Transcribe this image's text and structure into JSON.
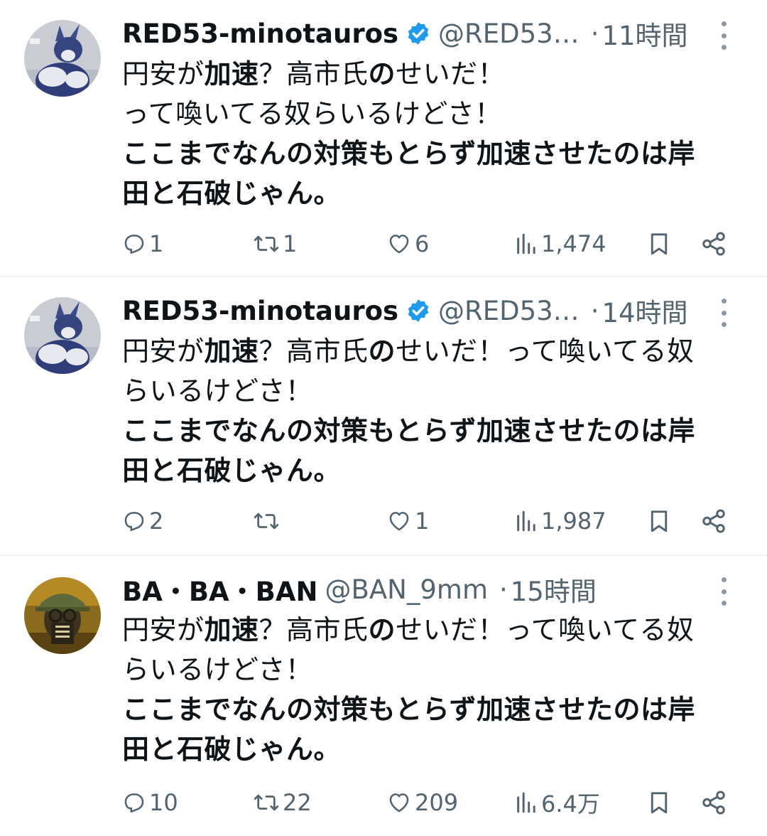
{
  "tweets": [
    {
      "display_name": "RED53-minotauros",
      "handle": "@RED53…",
      "separator": "·",
      "time": "11時間",
      "verified": true,
      "lines": [
        {
          "runs": [
            {
              "t": "円安が",
              "b": false
            },
            {
              "t": "加速",
              "b": true
            },
            {
              "t": "？高市氏",
              "b": false
            },
            {
              "t": "の",
              "b": true
            },
            {
              "t": "せいだ！",
              "b": false
            }
          ]
        },
        {
          "runs": [
            {
              "t": "って喚いてる奴らいるけどさ！",
              "b": false
            }
          ]
        },
        {
          "runs": [
            {
              "t": "ここまでなんの対策もとらず加速させたのは岸",
              "b": true
            }
          ]
        },
        {
          "runs": [
            {
              "t": "田と石破じゃん。",
              "b": true
            }
          ]
        }
      ],
      "stats": {
        "replies": "1",
        "reposts": "1",
        "likes": "6",
        "views": "1,474"
      }
    },
    {
      "display_name": "RED53-minotauros",
      "handle": "@RED53…",
      "separator": "·",
      "time": "14時間",
      "verified": true,
      "lines": [
        {
          "runs": [
            {
              "t": "円安が",
              "b": false
            },
            {
              "t": "加速",
              "b": true
            },
            {
              "t": "？高市氏",
              "b": false
            },
            {
              "t": "の",
              "b": true
            },
            {
              "t": "せいだ！って喚いてる奴",
              "b": false
            }
          ]
        },
        {
          "runs": [
            {
              "t": "らいるけどさ！",
              "b": false
            }
          ]
        },
        {
          "runs": [
            {
              "t": "ここまでなんの対策もとらず加速させたのは岸",
              "b": true
            }
          ]
        },
        {
          "runs": [
            {
              "t": "田と石破じゃん。",
              "b": true
            }
          ]
        }
      ],
      "stats": {
        "replies": "2",
        "reposts": "",
        "likes": "1",
        "views": "1,987"
      }
    },
    {
      "display_name": "BA・BA・BAN",
      "handle": "@BAN_9mm",
      "separator": "·",
      "time": "15時間",
      "verified": false,
      "lines": [
        {
          "runs": [
            {
              "t": "円安が",
              "b": false
            },
            {
              "t": "加速",
              "b": true
            },
            {
              "t": "？高市氏",
              "b": false
            },
            {
              "t": "の",
              "b": true
            },
            {
              "t": "せいだ！って喚いてる奴",
              "b": false
            }
          ]
        },
        {
          "runs": [
            {
              "t": "らいるけどさ！",
              "b": false
            }
          ]
        },
        {
          "runs": [
            {
              "t": "ここまでなんの対策もとらず加速させたのは岸",
              "b": true
            }
          ]
        },
        {
          "runs": [
            {
              "t": "田と石破じゃん。",
              "b": true
            }
          ]
        }
      ],
      "stats": {
        "replies": "10",
        "reposts": "22",
        "likes": "209",
        "views": "6.4万"
      }
    }
  ],
  "icons": {
    "reply": "reply-icon",
    "repost": "repost-icon",
    "like": "heart-icon",
    "views": "views-icon",
    "bookmark": "bookmark-icon",
    "share": "share-icon",
    "more": "more-icon",
    "verified": "verified-badge-icon"
  },
  "colors": {
    "text": "#0f1419",
    "secondary": "#536471",
    "verified": "#1d9bf0",
    "divider": "#eff3f4"
  }
}
